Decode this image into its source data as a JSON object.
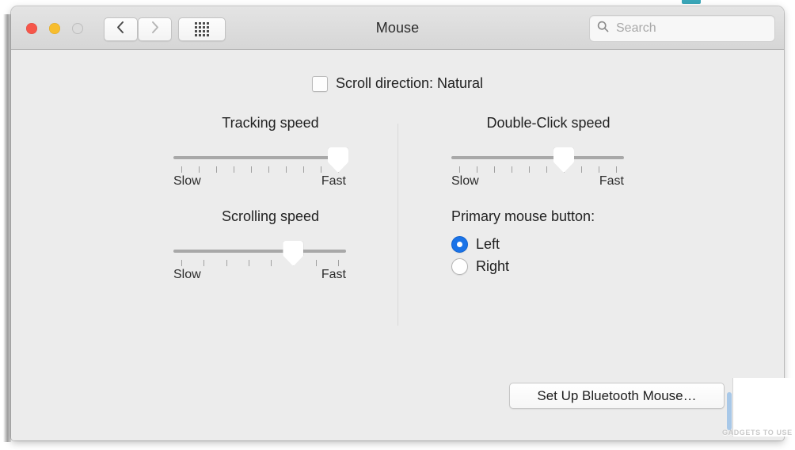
{
  "window": {
    "title": "Mouse",
    "traffic_lights": [
      "close",
      "minimize",
      "zoom"
    ],
    "nav": {
      "back_icon": "chevron-left-icon",
      "forward_icon": "chevron-right-icon",
      "grid_icon": "grid-dots-icon"
    },
    "search": {
      "placeholder": "Search",
      "value": "",
      "icon": "search-icon"
    }
  },
  "content": {
    "scroll_direction": {
      "label": "Scroll direction: Natural",
      "checked": false
    },
    "sliders": [
      {
        "key": "tracking",
        "title": "Tracking speed",
        "low_label": "Slow",
        "high_label": "Fast",
        "ticks": 10,
        "value_index": 9,
        "min_index": 0,
        "max_index": 9
      },
      {
        "key": "scrolling",
        "title": "Scrolling speed",
        "low_label": "Slow",
        "high_label": "Fast",
        "ticks": 8,
        "value_index": 5,
        "min_index": 0,
        "max_index": 7
      },
      {
        "key": "double_click",
        "title": "Double-Click speed",
        "low_label": "Slow",
        "high_label": "Fast",
        "ticks": 10,
        "value_index": 6,
        "min_index": 0,
        "max_index": 9
      }
    ],
    "primary_mouse_button": {
      "title": "Primary mouse button:",
      "options": [
        {
          "label": "Left",
          "selected": true
        },
        {
          "label": "Right",
          "selected": false
        }
      ]
    },
    "bluetooth_button": {
      "label": "Set Up Bluetooth Mouse…"
    }
  },
  "overlay": {
    "watermark": "GADGETS TO USE"
  },
  "colors": {
    "accent": "#1a73e8",
    "window_bg": "#ececec",
    "titlebar_bg": "#dcdcdc",
    "track": "#a8a8a8",
    "close": "#f6564a",
    "minimize": "#f7bd2e",
    "zoom_disabled": "#dcdcdc"
  }
}
